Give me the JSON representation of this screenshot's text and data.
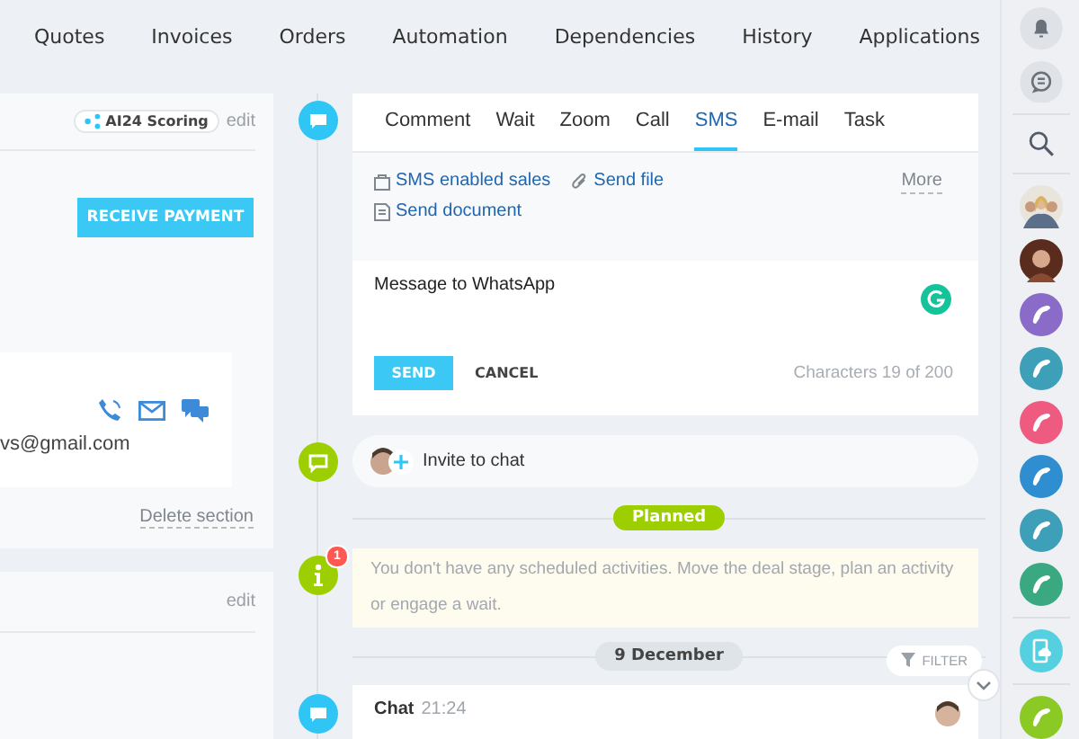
{
  "nav": {
    "items": [
      "Quotes",
      "Invoices",
      "Orders",
      "Automation",
      "Dependencies",
      "History",
      "Applications"
    ]
  },
  "deal_panel": {
    "badge": "AI24 Scoring",
    "edit": "edit",
    "receive_payment": "RECEIVE PAYMENT",
    "email": "vs@gmail.com",
    "delete_section": "Delete section"
  },
  "second_panel": {
    "edit": "edit"
  },
  "activity": {
    "tabs": [
      {
        "label": "Comment",
        "selected": false
      },
      {
        "label": "Wait",
        "selected": false
      },
      {
        "label": "Zoom",
        "selected": false
      },
      {
        "label": "Call",
        "selected": false
      },
      {
        "label": "SMS",
        "selected": true
      },
      {
        "label": "E-mail",
        "selected": false
      },
      {
        "label": "Task",
        "selected": false
      }
    ],
    "actions": [
      {
        "kind": "bag",
        "label": "SMS enabled sales"
      },
      {
        "kind": "clip",
        "label": "Send file"
      },
      {
        "kind": "doc",
        "label": "Send document"
      }
    ],
    "more": "More",
    "message": "Message to WhatsApp",
    "send": "SEND",
    "cancel": "CANCEL",
    "counter": "Characters 19 of 200"
  },
  "invite": {
    "label": "Invite to chat"
  },
  "planned": "Planned",
  "notice": {
    "badge": "1",
    "text": "You don't have any scheduled activities. Move the deal stage, plan an activity or engage a wait."
  },
  "date": "9 December",
  "filter": "FILTER",
  "chat": {
    "title": "Chat",
    "time": "21:24"
  },
  "sidebar": {
    "contacts": [
      {
        "kind": "group"
      },
      {
        "kind": "photo"
      },
      {
        "kind": "call",
        "color": "#8a6cc8"
      },
      {
        "kind": "call",
        "color": "#3e9fb8"
      },
      {
        "kind": "call",
        "color": "#ee5a80"
      },
      {
        "kind": "call",
        "color": "#2f8ecf"
      },
      {
        "kind": "call",
        "color": "#3e9fb8"
      },
      {
        "kind": "call",
        "color": "#3aa982"
      }
    ]
  }
}
